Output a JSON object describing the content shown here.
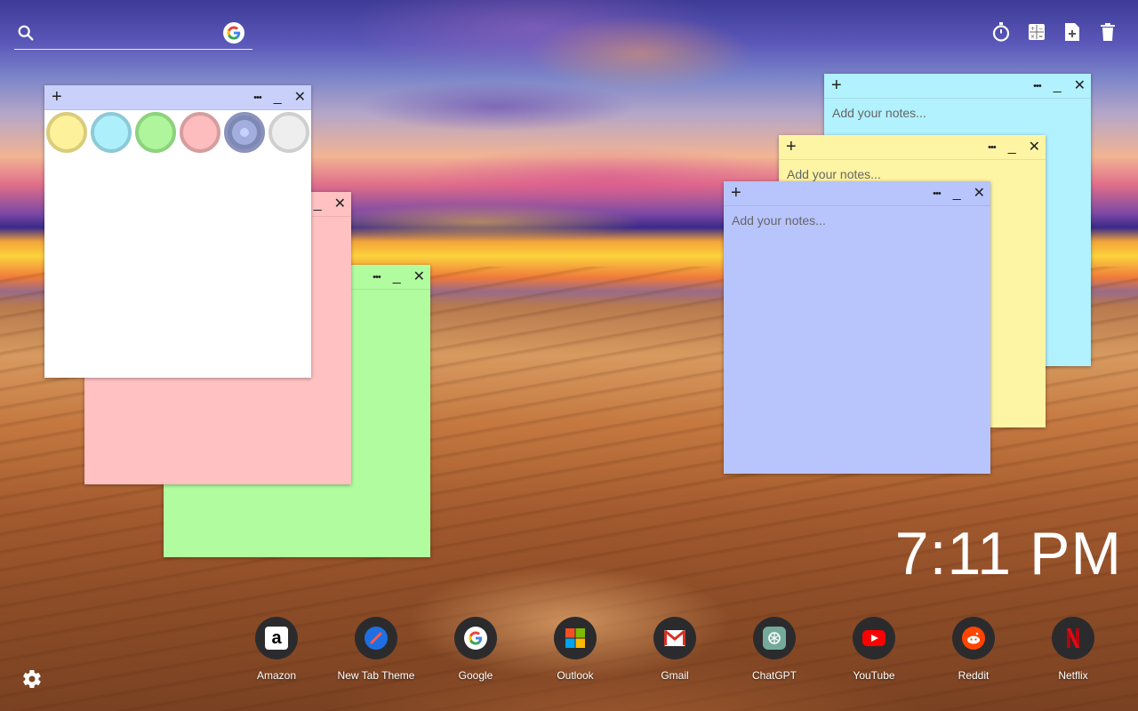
{
  "search": {
    "placeholder": "",
    "engine_logo": "G"
  },
  "toolbar": {
    "icons": [
      "stopwatch-icon",
      "calculator-icon",
      "add-note-icon",
      "trash-icon"
    ]
  },
  "notes": {
    "placeholder": "Add your notes...",
    "white": {
      "color": "#ffffff",
      "bar_color": "#c9d1fa"
    },
    "pink": {
      "color": "#ffc1c2"
    },
    "green": {
      "color": "#b1fc9f"
    },
    "cyan": {
      "color": "#b2f1fe"
    },
    "yellow": {
      "color": "#fdf4a4"
    },
    "blue": {
      "color": "#b8c4fc"
    },
    "controls": {
      "add": "+",
      "menu": "•••",
      "minimize": "_",
      "close": "✕"
    }
  },
  "color_palette": [
    {
      "name": "yellow",
      "fill": "#fdf19b",
      "ring": "#d9cd7b"
    },
    {
      "name": "cyan",
      "fill": "#aeeffc",
      "ring": "#8ec9d7"
    },
    {
      "name": "green",
      "fill": "#aef59c",
      "ring": "#8dd27c"
    },
    {
      "name": "pink",
      "fill": "#fdbcbd",
      "ring": "#d69d9e"
    },
    {
      "name": "blue",
      "fill": "#b6c3fa",
      "ring": "#7f88b3",
      "selected": true
    },
    {
      "name": "white",
      "fill": "#eeeeee",
      "ring": "#cfcfcf"
    }
  ],
  "clock": {
    "time": "7:11 PM"
  },
  "dock": [
    {
      "label": "Amazon",
      "icon": "amazon-icon"
    },
    {
      "label": "New Tab Theme",
      "icon": "new-tab-theme-icon"
    },
    {
      "label": "Google",
      "icon": "google-icon"
    },
    {
      "label": "Outlook",
      "icon": "outlook-icon"
    },
    {
      "label": "Gmail",
      "icon": "gmail-icon"
    },
    {
      "label": "ChatGPT",
      "icon": "chatgpt-icon"
    },
    {
      "label": "YouTube",
      "icon": "youtube-icon"
    },
    {
      "label": "Reddit",
      "icon": "reddit-icon"
    },
    {
      "label": "Netflix",
      "icon": "netflix-icon"
    }
  ],
  "settings": {
    "icon": "gear-icon"
  }
}
